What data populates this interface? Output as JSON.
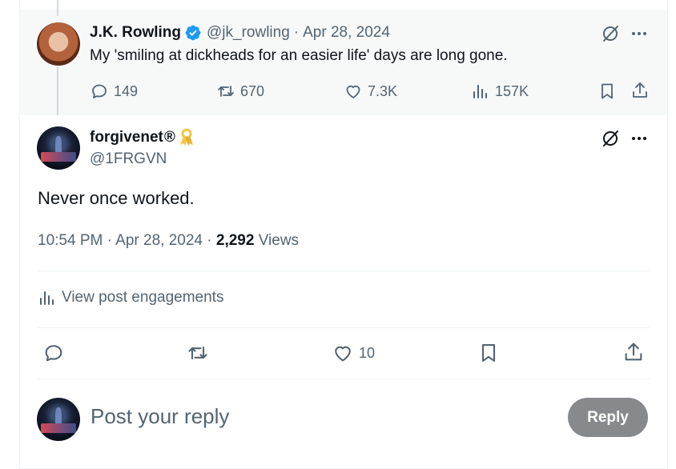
{
  "parent_tweet": {
    "name": "J.K. Rowling",
    "handle": "@jk_rowling",
    "separator": "·",
    "date": "Apr 28, 2024",
    "text": "My 'smiling at dickheads for an easier life' days are long gone.",
    "stats": {
      "replies": "149",
      "reposts": "670",
      "likes": "7.3K",
      "views": "157K"
    }
  },
  "main_tweet": {
    "name": "forgivenet",
    "name_suffix": "®",
    "handle": "@1FRGVN",
    "text": "Never once worked.",
    "time": "10:54 PM",
    "separator": "·",
    "date": "Apr 28, 2024",
    "views_count": "2,292",
    "views_label": "Views",
    "engagements_label": "View post engagements",
    "likes": "10"
  },
  "reply": {
    "placeholder": "Post your reply",
    "button_label": "Reply"
  },
  "colors": {
    "verified": "#1d9bf0",
    "ribbon": "#f5c542",
    "muted": "#536471",
    "reply_button": "#87898c"
  },
  "icons": [
    "verified-badge-icon",
    "grok-icon",
    "more-icon",
    "reply-icon",
    "repost-icon",
    "like-icon",
    "views-icon",
    "bookmark-icon",
    "share-icon",
    "ribbon-icon",
    "engagements-icon"
  ]
}
